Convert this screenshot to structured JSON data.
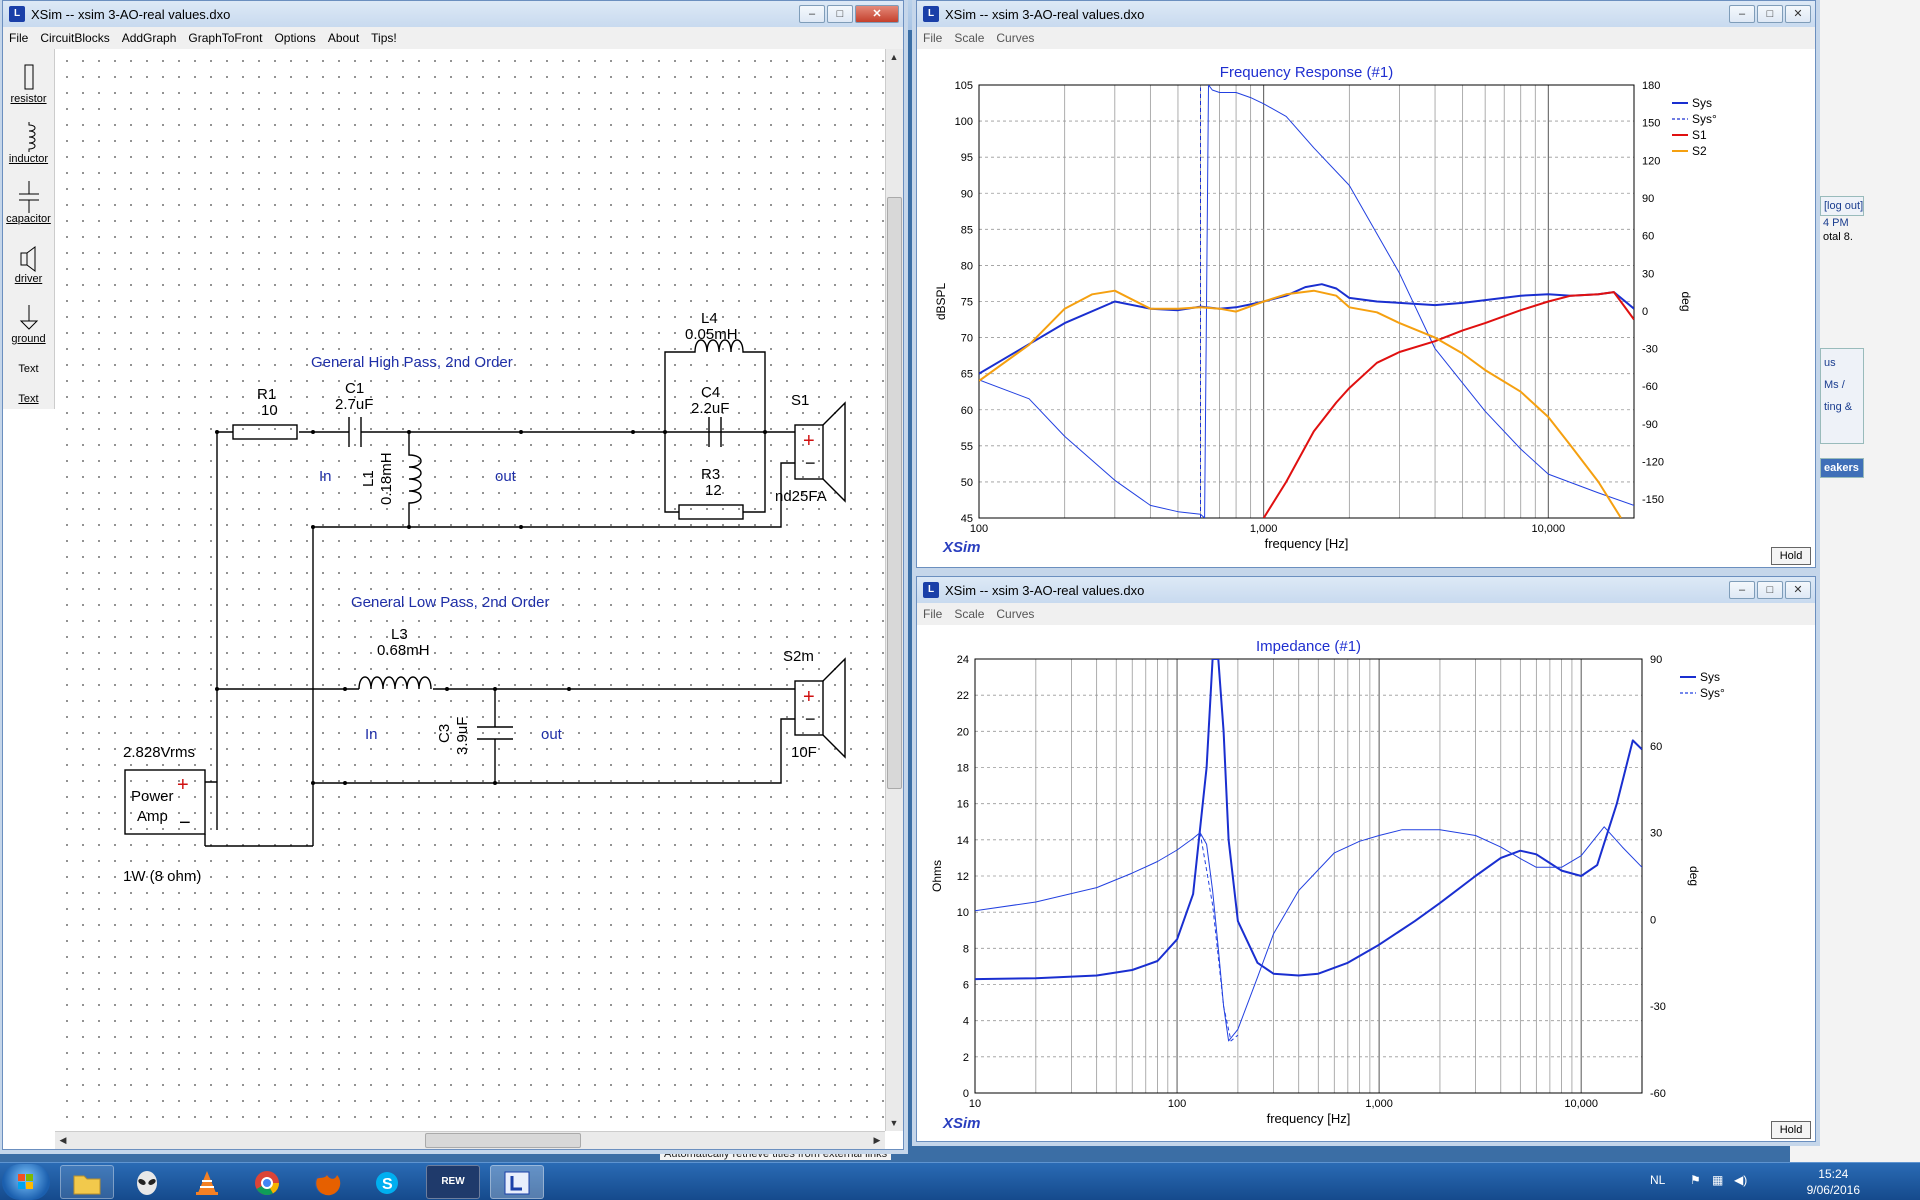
{
  "schematic_window": {
    "title": "XSim -- xsim 3-AO-real values.dxo",
    "menu": [
      "File",
      "CircuitBlocks",
      "AddGraph",
      "GraphToFront",
      "Options",
      "About",
      "Tips!"
    ],
    "tools": [
      "resistor",
      "inductor",
      "capacitor",
      "driver",
      "ground",
      "Text",
      "Text"
    ],
    "hp_title": "General High Pass, 2nd Order",
    "lp_title": "General Low Pass, 2nd Order",
    "R1": {
      "name": "R1",
      "value": "10"
    },
    "C1": {
      "name": "C1",
      "value": "2.7uF"
    },
    "L1": {
      "name": "L1",
      "value": "0.18mH"
    },
    "L4": {
      "name": "L4",
      "value": "0.05mH"
    },
    "C4": {
      "name": "C4",
      "value": "2.2uF"
    },
    "R3": {
      "name": "R3",
      "value": "12"
    },
    "S1": {
      "name": "S1",
      "model": "nd25FA"
    },
    "L3": {
      "name": "L3",
      "value": "0.68mH"
    },
    "C3": {
      "name": "C3",
      "value": "3.9uF"
    },
    "S2": {
      "name": "S2m",
      "model": "10F"
    },
    "in_label": "In",
    "out_label": "out",
    "amp": {
      "voltage": "2.828Vrms",
      "line1": "Power",
      "line2": "Amp",
      "rating": "1W (8 ohm)",
      "plus": "+",
      "minus": "−"
    }
  },
  "fr_window": {
    "title": "XSim -- xsim 3-AO-real values.dxo",
    "menu": [
      "File",
      "Scale",
      "Curves"
    ],
    "logo": "XSim",
    "hold": "Hold"
  },
  "imp_window": {
    "title": "XSim -- xsim 3-AO-real values.dxo",
    "menu": [
      "File",
      "Scale",
      "Curves"
    ],
    "logo": "XSim",
    "hold": "Hold"
  },
  "chart_data": [
    {
      "type": "line",
      "title": "Frequency Response (#1)",
      "xlabel": "frequency [Hz]",
      "ylabel": "dBSPL",
      "y2label": "deg",
      "xscale": "log",
      "xlim": [
        100,
        20000
      ],
      "ylim": [
        45,
        105
      ],
      "y2lim": [
        -165,
        180
      ],
      "xticklabels": [
        "100",
        "1,000",
        "10,000"
      ],
      "yticks": [
        45,
        50,
        55,
        60,
        65,
        70,
        75,
        80,
        85,
        90,
        95,
        100,
        105
      ],
      "y2ticks": [
        -150,
        -120,
        -90,
        -60,
        -30,
        0,
        30,
        60,
        90,
        120,
        150,
        180
      ],
      "grid": true,
      "legend": "top-right",
      "series": [
        {
          "name": "Sys",
          "axis": "y",
          "style": "solid",
          "color": "#1a2fd0",
          "x": [
            100,
            200,
            300,
            400,
            500,
            600,
            700,
            800,
            900,
            1000,
            1200,
            1400,
            1600,
            1800,
            2000,
            2500,
            3000,
            4000,
            5000,
            6000,
            8000,
            10000,
            12000,
            15000,
            17000,
            20000
          ],
          "y": [
            65,
            72,
            75,
            74,
            73.8,
            74.3,
            74,
            74.2,
            74.6,
            75,
            75.8,
            77,
            77.4,
            76.8,
            75.5,
            75,
            74.8,
            74.5,
            74.8,
            75.2,
            75.8,
            76,
            75.8,
            76,
            76.3,
            74
          ]
        },
        {
          "name": "Sys°",
          "axis": "y2",
          "style": "dashed",
          "color": "#1a2fd0",
          "x": [
            600,
            600
          ],
          "y": [
            -165,
            178
          ]
        },
        {
          "name": "Sys°",
          "axis": "y2",
          "style": "solid-thin",
          "color": "#2240e0",
          "x": [
            100,
            150,
            200,
            300,
            400,
            500,
            600,
            620,
            640,
            660,
            700,
            800,
            900,
            1000,
            1200,
            1500,
            2000,
            3000,
            4000,
            6000,
            8000,
            10000,
            15000,
            20000
          ],
          "y": [
            -55,
            -70,
            -100,
            -135,
            -155,
            -160,
            -162,
            -165,
            180,
            176,
            174,
            174,
            170,
            165,
            155,
            130,
            100,
            30,
            -30,
            -80,
            -110,
            -130,
            -145,
            -155
          ]
        },
        {
          "name": "S1",
          "axis": "y",
          "style": "solid",
          "color": "#e01010",
          "x": [
            1000,
            1200,
            1500,
            1800,
            2000,
            2500,
            3000,
            4000,
            5000,
            6000,
            8000,
            10000,
            12000,
            15000,
            17000,
            20000
          ],
          "y": [
            45,
            50,
            57,
            61,
            63,
            66.5,
            68,
            69.5,
            71,
            72,
            73.8,
            75,
            75.8,
            76,
            76.3,
            72.5
          ]
        },
        {
          "name": "S2",
          "axis": "y",
          "style": "solid",
          "color": "#f5a010",
          "x": [
            100,
            150,
            200,
            250,
            300,
            400,
            500,
            600,
            700,
            800,
            1000,
            1200,
            1500,
            1800,
            2000,
            2500,
            3000,
            4000,
            5000,
            6000,
            8000,
            10000,
            12000,
            15000,
            18000
          ],
          "y": [
            64,
            69,
            74,
            76,
            76.5,
            74,
            74,
            74.2,
            74,
            73.6,
            75,
            76,
            76.5,
            75.8,
            74.2,
            73.5,
            72,
            70,
            67.8,
            65.5,
            62.5,
            59,
            55,
            50,
            45
          ]
        }
      ]
    },
    {
      "type": "line",
      "title": "Impedance (#1)",
      "xlabel": "frequency [Hz]",
      "ylabel": "Ohms",
      "y2label": "deg",
      "xscale": "log",
      "xlim": [
        10,
        20000
      ],
      "ylim": [
        0,
        24
      ],
      "y2lim": [
        -60,
        90
      ],
      "xticklabels": [
        "10",
        "100",
        "1,000",
        "10,000"
      ],
      "yticks": [
        0,
        2,
        4,
        6,
        8,
        10,
        12,
        14,
        16,
        18,
        20,
        22,
        24
      ],
      "y2ticks": [
        -60,
        -30,
        0,
        30,
        60,
        90
      ],
      "grid": true,
      "legend": "top-right",
      "series": [
        {
          "name": "Sys",
          "axis": "y",
          "style": "solid",
          "color": "#1a2fd0",
          "x": [
            10,
            20,
            40,
            60,
            80,
            100,
            120,
            140,
            150,
            160,
            170,
            180,
            200,
            250,
            300,
            400,
            500,
            700,
            1000,
            1500,
            2000,
            3000,
            4000,
            5000,
            6000,
            8000,
            10000,
            12000,
            15000,
            18000,
            20000
          ],
          "y": [
            6.3,
            6.35,
            6.5,
            6.8,
            7.3,
            8.5,
            11,
            18,
            24,
            24,
            20,
            14,
            9.5,
            7.2,
            6.6,
            6.5,
            6.6,
            7.2,
            8.2,
            9.5,
            10.5,
            12,
            13,
            13.4,
            13.2,
            12.3,
            12,
            12.6,
            16,
            19.5,
            19
          ]
        },
        {
          "name": "Sys°",
          "axis": "y2",
          "style": "solid-thin",
          "color": "#2240e0",
          "x": [
            10,
            20,
            40,
            60,
            80,
            100,
            120,
            130,
            140,
            150,
            160,
            170,
            180,
            200,
            250,
            300,
            400,
            600,
            800,
            1000,
            1300,
            2000,
            3000,
            4000,
            5000,
            6000,
            8000,
            10000,
            13000,
            16000,
            20000
          ],
          "y": [
            3,
            6,
            11,
            16,
            20,
            24,
            28,
            30,
            26,
            10,
            -10,
            -30,
            -42,
            -38,
            -20,
            -5,
            10,
            23,
            27,
            29,
            31,
            31,
            29,
            25,
            21,
            18,
            18,
            22,
            32,
            25,
            18
          ]
        },
        {
          "name": "Sys°",
          "axis": "y2",
          "style": "dashed",
          "color": "#2240e0",
          "x": [
            130,
            150,
            170,
            185,
            200
          ],
          "y": [
            30,
            5,
            -30,
            -42,
            -40
          ]
        }
      ]
    }
  ],
  "taskbar": {
    "apps": [
      "Explorer",
      "Alienware",
      "VLC",
      "Chrome",
      "Firefox",
      "Skype",
      "REW",
      "XSim"
    ],
    "rew_label": "REW",
    "lang": "NL",
    "time": "15:24",
    "date": "9/06/2016"
  },
  "background_text": {
    "side1": "[log out]",
    "side2": "4 PM",
    "side3": "otal 8.",
    "side4": "us",
    "side5": "Ms /",
    "side6": "ting &",
    "side7": "eakers",
    "bottom_note": "Automatically retrieve titles from external links"
  },
  "colors": {
    "sys": "#1a2fd0",
    "s1": "#e01010",
    "s2": "#f5a010",
    "grid": "#888888",
    "component": "#000000",
    "label_blue": "#1f2fa8"
  }
}
